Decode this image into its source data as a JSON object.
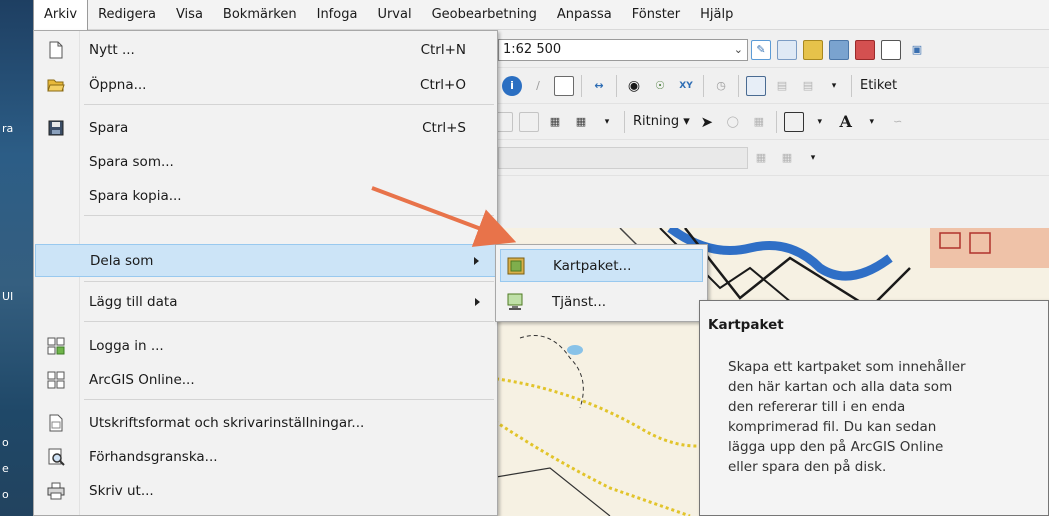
{
  "menubar": {
    "items": [
      "Arkiv",
      "Redigera",
      "Visa",
      "Bokmärken",
      "Infoga",
      "Urval",
      "Geobearbetning",
      "Anpassa",
      "Fönster",
      "Hjälp"
    ]
  },
  "toolbar": {
    "scale_value": "1:62 500",
    "ritning_label": "Ritning",
    "etikett_label": "Etiket",
    "text_tool_glyph": "A"
  },
  "file_menu": {
    "items": [
      {
        "label": "Nytt ...",
        "shortcut": "Ctrl+N",
        "icon": "new-document-icon"
      },
      {
        "label": "Öppna...",
        "shortcut": "Ctrl+O",
        "icon": "open-folder-icon"
      },
      {
        "label": "Spara",
        "shortcut": "Ctrl+S",
        "icon": "save-disk-icon"
      },
      {
        "label": "Spara som...",
        "shortcut": ""
      },
      {
        "label": "Spara kopia...",
        "shortcut": ""
      },
      {
        "label": "Dela som",
        "shortcut": "",
        "submenu": true
      },
      {
        "label": "Lägg till data",
        "shortcut": "",
        "submenu": true
      },
      {
        "label": "Logga in ...",
        "shortcut": "",
        "icon": "sign-in-grid-icon"
      },
      {
        "label": "ArcGIS Online...",
        "shortcut": "",
        "icon": "arcgis-online-grid-icon"
      },
      {
        "label": "Utskriftsformat och skrivarinställningar...",
        "shortcut": "",
        "icon": "page-setup-icon"
      },
      {
        "label": "Förhandsgranska...",
        "shortcut": "",
        "icon": "print-preview-icon"
      },
      {
        "label": "Skriv ut...",
        "shortcut": "",
        "icon": "printer-icon"
      }
    ]
  },
  "submenu": {
    "items": [
      {
        "label": "Kartpaket...",
        "icon": "map-package-icon"
      },
      {
        "label": "Tjänst...",
        "icon": "service-icon"
      }
    ]
  },
  "tooltip": {
    "title": "Kartpaket",
    "lines": [
      "Skapa ett kartpaket som innehåller",
      "den här kartan och alla data som",
      "den refererar till i en enda",
      "komprimerad fil. Du kan sedan",
      "lägga upp den på ArcGIS Online",
      "eller spara den på disk."
    ]
  },
  "desktop": {
    "fragments": [
      "ra",
      "UI",
      "o",
      "e",
      "o"
    ]
  },
  "colors": {
    "highlight": "#cce4f7",
    "highlight_border": "#99c9ef",
    "annotation_arrow": "#e8734a"
  }
}
